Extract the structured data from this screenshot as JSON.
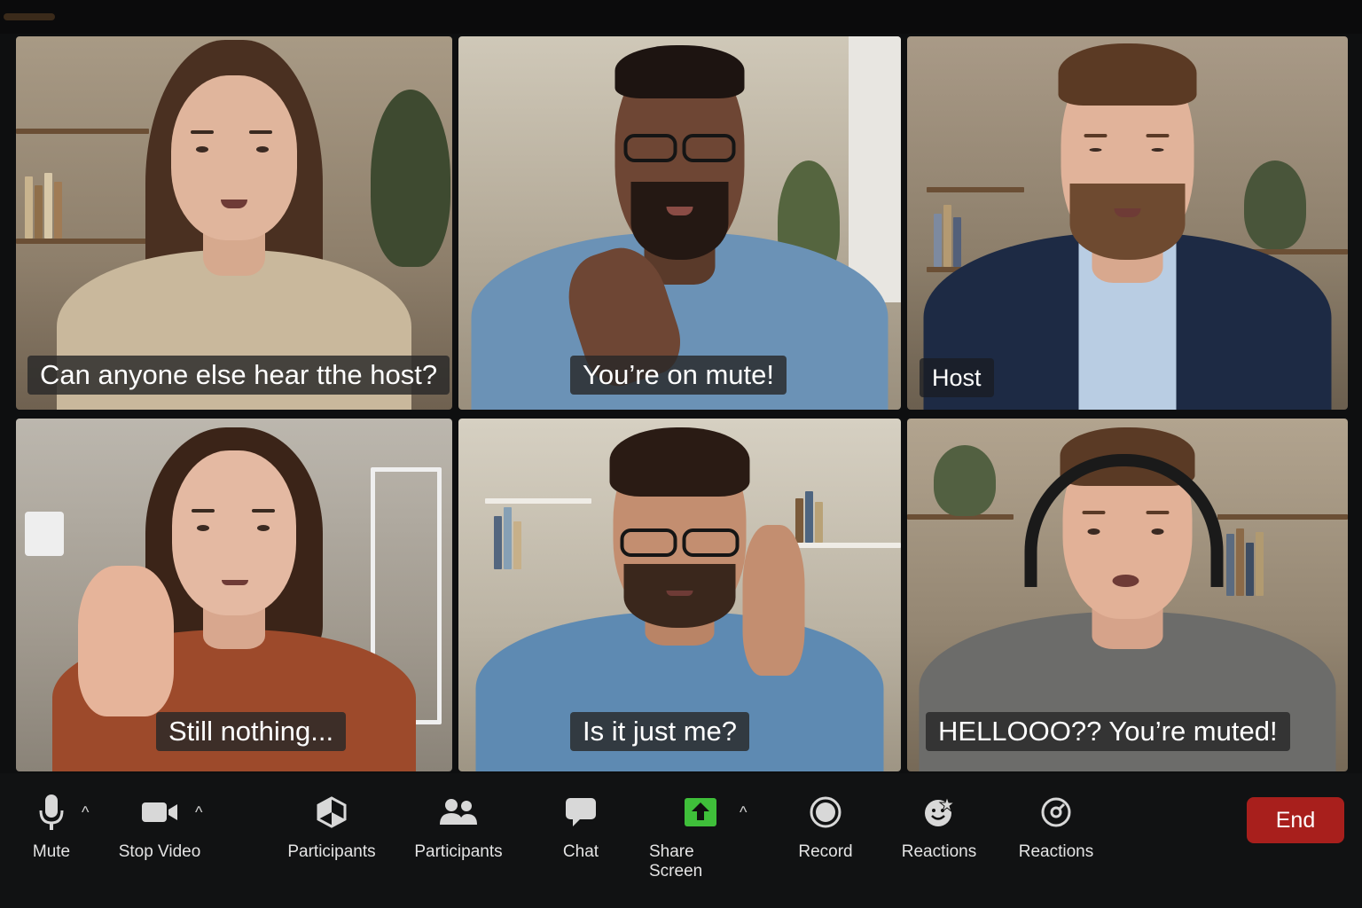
{
  "window": {
    "title": ""
  },
  "tiles": [
    {
      "caption": "Can anyone else hear tthe host?"
    },
    {
      "caption": "You’re on mute!"
    },
    {
      "caption": "Host"
    },
    {
      "caption": "Still nothing..."
    },
    {
      "caption": "Is it just me?"
    },
    {
      "caption": "HELLOOO?? You’re muted!"
    }
  ],
  "toolbar": {
    "mute": "Mute",
    "stop_video": "Stop Video",
    "participants_1": "Participants",
    "participants_2": "Participants",
    "chat": "Chat",
    "share_screen": "Share Screen",
    "record": "Record",
    "reactions_1": "Reactions",
    "reactions_2": "Reactions",
    "end": "End",
    "caret": "^"
  },
  "icons": {
    "mute": "microphone-icon",
    "stop_video": "video-camera-icon",
    "participants_1": "cube-icon",
    "participants_2": "people-icon",
    "chat": "chat-bubble-icon",
    "share_screen": "share-up-arrow-icon",
    "record": "record-circle-icon",
    "reactions_1": "emoji-icon",
    "reactions_2": "reaction-circle-icon"
  },
  "colors": {
    "background": "#0e0f10",
    "end_button": "#a81f1c",
    "share_accent": "#3fbf3a",
    "caption_bg": "#2a2a2a"
  }
}
